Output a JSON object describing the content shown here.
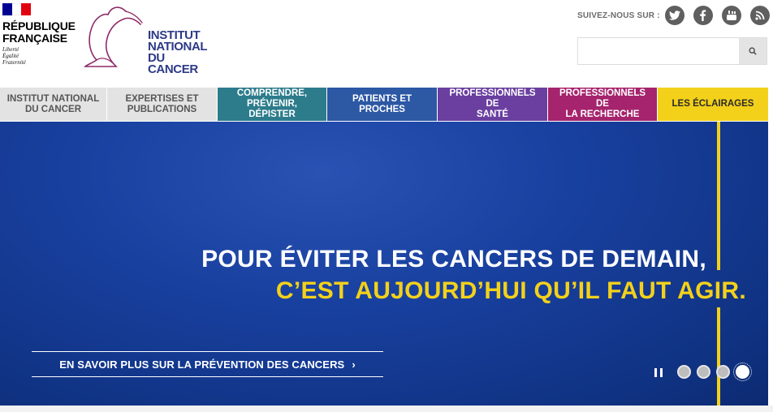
{
  "republique": {
    "title_line1": "RÉPUBLIQUE",
    "title_line2": "FRANÇAISE",
    "motto_1": "Liberté",
    "motto_2": "Égalité",
    "motto_3": "Fraternité",
    "flag_colors": [
      "#000091",
      "#ffffff",
      "#e1000f"
    ]
  },
  "logo": {
    "line1": "INSTITUT",
    "line2": "NATIONAL",
    "line3": "DU CANCER",
    "accent_color": "#8e2a66",
    "text_color": "#2e3a87"
  },
  "social": {
    "label": "SUIVEZ-NOUS SUR :",
    "icons": [
      "twitter-icon",
      "facebook-icon",
      "youtube-icon",
      "rss-icon"
    ]
  },
  "search": {
    "placeholder": "",
    "value": "",
    "icon": "search-icon"
  },
  "nav": {
    "items": [
      {
        "line1": "INSTITUT NATIONAL",
        "line2": "DU CANCER",
        "bg": "#e3e3e3",
        "fg": "#555555"
      },
      {
        "line1": "EXPERTISES ET",
        "line2": "PUBLICATIONS",
        "bg": "#e3e3e3",
        "fg": "#555555"
      },
      {
        "line1": "COMPRENDRE,",
        "line2": "PRÉVENIR, DÉPISTER",
        "bg": "#2d7c8c",
        "fg": "#ffffff"
      },
      {
        "line1": "PATIENTS ET",
        "line2": "PROCHES",
        "bg": "#2c58a4",
        "fg": "#ffffff"
      },
      {
        "line1": "PROFESSIONNELS DE",
        "line2": "SANTÉ",
        "bg": "#6a3fa0",
        "fg": "#ffffff"
      },
      {
        "line1": "PROFESSIONNELS DE",
        "line2": "LA RECHERCHE",
        "bg": "#a5246d",
        "fg": "#ffffff"
      },
      {
        "line1": "LES ÉCLAIRAGES",
        "line2": "",
        "bg": "#f3d11a",
        "fg": "#2a2a2a"
      }
    ]
  },
  "hero": {
    "headline_1": "POUR ÉVITER LES CANCERS DE DEMAIN,",
    "headline_2": "C’EST AUJOURD’HUI QU’IL FAUT AGIR.",
    "cta_label": "EN SAVOIR PLUS SUR LA PRÉVENTION DES CANCERS",
    "cta_chevron": "›",
    "accent_color": "#f3d11a",
    "slide_count": 4,
    "active_slide": 4
  }
}
